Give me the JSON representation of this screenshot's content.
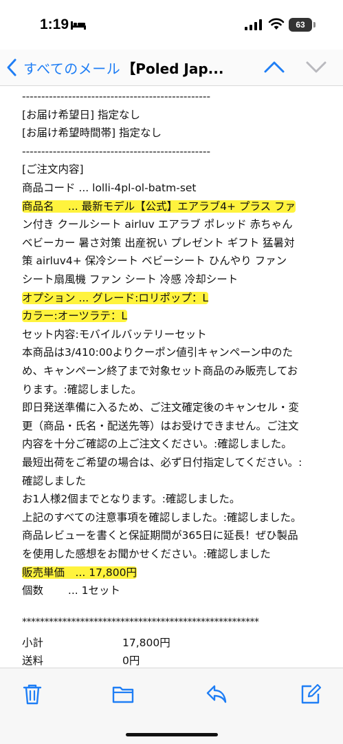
{
  "status_bar": {
    "time": "1:19",
    "battery": "63"
  },
  "nav": {
    "back_label": "すべてのメール",
    "title": "【Poled Jap..."
  },
  "email_lines": [
    {
      "text": "-------------------------------------------------",
      "highlight": false
    },
    {
      "text": "[お届け希望日] 指定なし",
      "highlight": false
    },
    {
      "text": "[お届け希望時間帯] 指定なし",
      "highlight": false
    },
    {
      "text": "-------------------------------------------------",
      "highlight": false
    },
    {
      "text": "[ご注文内容]",
      "highlight": false
    },
    {
      "text": "商品コード ... lolli-4pl-ol-batm-set",
      "highlight": false
    },
    {
      "text": "商品名　 ... 最新モデル【公式】エアラブ4+ プラス ファ",
      "highlight": true
    },
    {
      "text": "ン付き クールシート airluv エアラブ ポレッド 赤ちゃん",
      "highlight": false
    },
    {
      "text": "ベビーカー 暑さ対策 出産祝い プレゼント ギフト 猛暑対",
      "highlight": false
    },
    {
      "text": "策 airluv4+ 保冷シート ベビーシート ひんやり ファン",
      "highlight": false
    },
    {
      "text": "シート扇風機 ファン シート 冷感 冷却シート",
      "highlight": false
    },
    {
      "text": "オプション ... グレード:ロリポップ：L",
      "highlight": true
    },
    {
      "text": "カラー:オーツラテ：L",
      "highlight": true
    },
    {
      "text": "セット内容:モバイルバッテリーセット",
      "highlight": false
    },
    {
      "text": "本商品は3/410:00よりクーポン値引キャンペーン中のた",
      "highlight": false
    },
    {
      "text": "め、キャンペーン終了まで対象セット商品のみ販売してお",
      "highlight": false
    },
    {
      "text": "ります。:確認しました。",
      "highlight": false
    },
    {
      "text": "即日発送準備に入るため、ご注文確定後のキャンセル・変",
      "highlight": false
    },
    {
      "text": "更（商品・氏名・配送先等）はお受けできません。ご注文",
      "highlight": false
    },
    {
      "text": "内容を十分ご確認の上ご注文ください。:確認しました。",
      "highlight": false
    },
    {
      "text": "最短出荷をご希望の場合は、必ず日付指定してください。:",
      "highlight": false
    },
    {
      "text": "確認しました",
      "highlight": false
    },
    {
      "text": "お1人様2個までとなります。:確認しました。",
      "highlight": false
    },
    {
      "text": "上記のすべての注意事項を確認しました。:確認しました。",
      "highlight": false
    },
    {
      "text": "商品レビューを書くと保証期間が365日に延長！ぜひ製品",
      "highlight": false
    },
    {
      "text": "を使用した感想をお聞かせください。:確認しました",
      "highlight": false
    },
    {
      "text": "販売単価　... 17,800円",
      "highlight": true
    },
    {
      "text": "個数　　 ... 1セット",
      "highlight": false
    }
  ],
  "separator_stars": "*****************************************************",
  "totals": [
    {
      "label": "小計",
      "value": "17,800円"
    },
    {
      "label": "送料",
      "value": "0円"
    }
  ],
  "toolbar": {
    "icons": [
      "trash-icon",
      "folder-icon",
      "reply-icon",
      "compose-icon"
    ],
    "accent": "#1f7ef5"
  },
  "colors": {
    "accent": "#1f7ef5",
    "highlight": "#fff33d"
  }
}
